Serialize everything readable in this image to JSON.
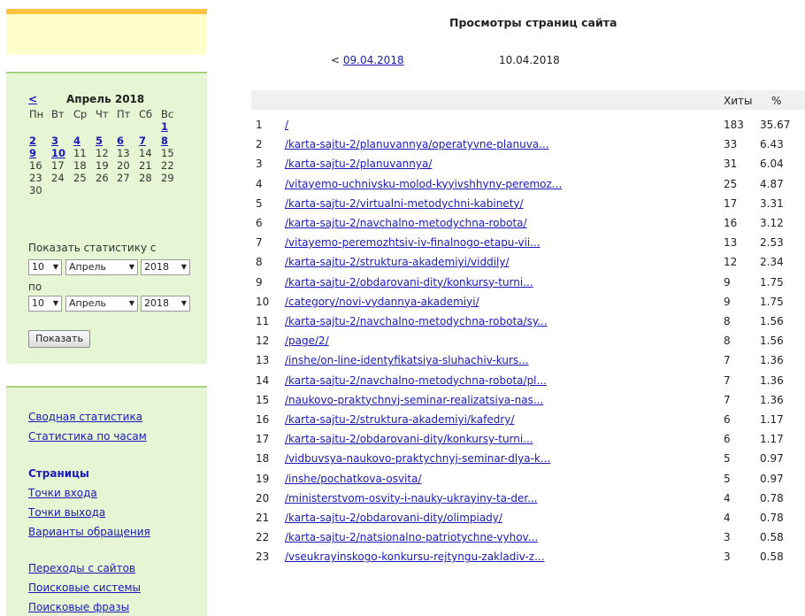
{
  "sidebar": {
    "calendar": {
      "prev": "<",
      "month": "Апрель 2018",
      "weekdays": [
        "Пн",
        "Вт",
        "Ср",
        "Чт",
        "Пт",
        "Сб",
        "Вс"
      ],
      "weeks": [
        [
          "",
          "",
          "",
          "",
          "",
          "",
          {
            "d": "1",
            "link": true
          }
        ],
        [
          {
            "d": "2",
            "link": true
          },
          {
            "d": "3",
            "link": true
          },
          {
            "d": "4",
            "link": true
          },
          {
            "d": "5",
            "link": true
          },
          {
            "d": "6",
            "link": true
          },
          {
            "d": "7",
            "link": true
          },
          {
            "d": "8",
            "link": true
          }
        ],
        [
          {
            "d": "9",
            "link": true
          },
          {
            "d": "10",
            "link": true
          },
          {
            "d": "11"
          },
          {
            "d": "12"
          },
          {
            "d": "13"
          },
          {
            "d": "14"
          },
          {
            "d": "15"
          }
        ],
        [
          {
            "d": "16"
          },
          {
            "d": "17"
          },
          {
            "d": "18"
          },
          {
            "d": "19"
          },
          {
            "d": "20"
          },
          {
            "d": "21"
          },
          {
            "d": "22"
          }
        ],
        [
          {
            "d": "23"
          },
          {
            "d": "24"
          },
          {
            "d": "25"
          },
          {
            "d": "26"
          },
          {
            "d": "27"
          },
          {
            "d": "28"
          },
          {
            "d": "29"
          }
        ],
        [
          {
            "d": "30"
          },
          "",
          "",
          "",
          "",
          "",
          ""
        ]
      ]
    },
    "period": {
      "from_label": "Показать статистику с",
      "to_label": "по",
      "from": {
        "day": "10",
        "month": "Апрель",
        "year": "2018"
      },
      "to": {
        "day": "10",
        "month": "Апрель",
        "year": "2018"
      },
      "submit": "Показать"
    },
    "nav": {
      "summary": "Сводная статистика",
      "hourly": "Статистика по часам",
      "pages_header": "Страницы",
      "entry": "Точки входа",
      "exit": "Точки выхода",
      "requests": "Варианты обращения",
      "referrers": "Переходы с сайтов",
      "search_engines": "Поисковые системы",
      "search_phrases": "Поисковые фразы"
    }
  },
  "main": {
    "title": "Просмотры страниц сайта",
    "prev_date": "09.04.2018",
    "prev_prefix": "< ",
    "current_date": "10.04.2018",
    "columns": {
      "hits": "Хиты",
      "percent": "%"
    },
    "rows": [
      {
        "n": "1",
        "page": "/",
        "hits": "183",
        "pct": "35.67"
      },
      {
        "n": "2",
        "page": "/karta-sajtu-2/planuvannya/operatyvne-planuva...",
        "hits": "33",
        "pct": "6.43"
      },
      {
        "n": "3",
        "page": "/karta-sajtu-2/planuvannya/",
        "hits": "31",
        "pct": "6.04"
      },
      {
        "n": "4",
        "page": "/vitayemo-uchnivsku-molod-kyyivshhyny-peremoz...",
        "hits": "25",
        "pct": "4.87"
      },
      {
        "n": "5",
        "page": "/karta-sajtu-2/virtualni-metodychni-kabinety/",
        "hits": "17",
        "pct": "3.31"
      },
      {
        "n": "6",
        "page": "/karta-sajtu-2/navchalno-metodychna-robota/",
        "hits": "16",
        "pct": "3.12"
      },
      {
        "n": "7",
        "page": "/vitayemo-peremozhtsiv-iv-finalnogo-etapu-vii...",
        "hits": "13",
        "pct": "2.53"
      },
      {
        "n": "8",
        "page": "/karta-sajtu-2/struktura-akademiyi/viddily/",
        "hits": "12",
        "pct": "2.34"
      },
      {
        "n": "9",
        "page": "/karta-sajtu-2/obdarovani-dity/konkursy-turni...",
        "hits": "9",
        "pct": "1.75"
      },
      {
        "n": "10",
        "page": "/category/novi-vydannya-akademiyi/",
        "hits": "9",
        "pct": "1.75"
      },
      {
        "n": "11",
        "page": "/karta-sajtu-2/navchalno-metodychna-robota/sy...",
        "hits": "8",
        "pct": "1.56"
      },
      {
        "n": "12",
        "page": "/page/2/",
        "hits": "8",
        "pct": "1.56"
      },
      {
        "n": "13",
        "page": "/inshe/on-line-identyfikatsiya-sluhachiv-kurs...",
        "hits": "7",
        "pct": "1.36"
      },
      {
        "n": "14",
        "page": "/karta-sajtu-2/navchalno-metodychna-robota/pl...",
        "hits": "7",
        "pct": "1.36"
      },
      {
        "n": "15",
        "page": "/naukovo-praktychnyj-seminar-realizatsiya-nas...",
        "hits": "7",
        "pct": "1.36"
      },
      {
        "n": "16",
        "page": "/karta-sajtu-2/struktura-akademiyi/kafedry/",
        "hits": "6",
        "pct": "1.17"
      },
      {
        "n": "17",
        "page": "/karta-sajtu-2/obdarovani-dity/konkursy-turni...",
        "hits": "6",
        "pct": "1.17"
      },
      {
        "n": "18",
        "page": "/vidbuvsya-naukovo-praktychnyj-seminar-dlya-k...",
        "hits": "5",
        "pct": "0.97"
      },
      {
        "n": "19",
        "page": "/inshe/pochatkova-osvita/",
        "hits": "5",
        "pct": "0.97"
      },
      {
        "n": "20",
        "page": "/ministerstvom-osvity-i-nauky-ukrayiny-ta-der...",
        "hits": "4",
        "pct": "0.78"
      },
      {
        "n": "21",
        "page": "/karta-sajtu-2/obdarovani-dity/olimpiady/",
        "hits": "4",
        "pct": "0.78"
      },
      {
        "n": "22",
        "page": "/karta-sajtu-2/natsionalno-patriotychne-vyhov...",
        "hits": "3",
        "pct": "0.58"
      },
      {
        "n": "23",
        "page": "/vseukrayinskogo-konkursu-rejtyngu-zakladiv-z...",
        "hits": "3",
        "pct": "0.58"
      }
    ]
  }
}
